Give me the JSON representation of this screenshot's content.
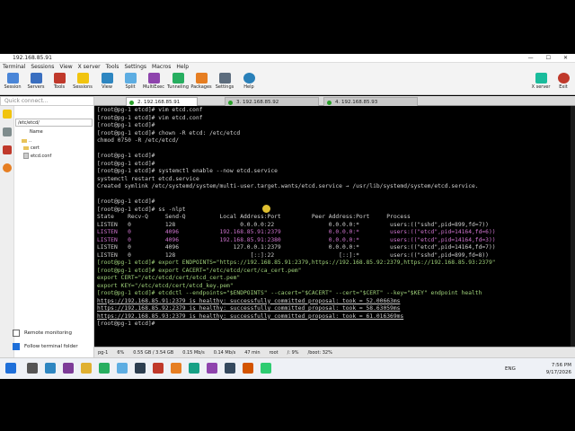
{
  "window": {
    "title": "192.168.85.91",
    "controls": [
      "—",
      "☐",
      "✕"
    ]
  },
  "menu": [
    "Terminal",
    "Sessions",
    "View",
    "X server",
    "Tools",
    "Settings",
    "Macros",
    "Help"
  ],
  "toolbar": {
    "items": [
      "Session",
      "Servers",
      "Tools",
      "Sessions",
      "View",
      "Split",
      "MultiExec",
      "Tunneling",
      "Packages",
      "Settings",
      "Help"
    ],
    "right": [
      "X server",
      "Exit"
    ]
  },
  "quick_connect": {
    "placeholder": "Quick connect..."
  },
  "sidebar": {
    "path": "/etc/etcd/",
    "header": "Name",
    "items": [
      "..",
      "cert",
      "etcd.conf"
    ],
    "remote_monitoring": "Remote monitoring",
    "follow_folder": "Follow terminal folder"
  },
  "tabs": [
    "2. 192.168.85.91",
    "3. 192.168.85.92",
    "4. 192.168.85.93"
  ],
  "terminal": {
    "lines": [
      "[root@pg-1 etcd]# vim etcd.conf",
      "[root@pg-1 etcd]# vim etcd.conf",
      "[root@pg-1 etcd]#",
      "[root@pg-1 etcd]# chown -R etcd: /etc/etcd",
      "chmod 0750 -R /etc/etcd/",
      "",
      "[root@pg-1 etcd]#",
      "[root@pg-1 etcd]#",
      "[root@pg-1 etcd]# systemctl enable --now etcd.service",
      "systemctl restart etcd.service",
      "Created symlink /etc/systemd/system/multi-user.target.wants/etcd.service → /usr/lib/systemd/system/etcd.service.",
      "",
      "[root@pg-1 etcd]#",
      "[root@pg-1 etcd]# ss -nlpt",
      "State    Recv-Q     Send-Q          Local Address:Port         Peer Address:Port     Process",
      "LISTEN   0          128                   0.0.0.0:22                0.0.0.0:*         users:((\"sshd\",pid=899,fd=7))",
      "LISTEN   0          4096            192.168.85.91:2379              0.0.0.0:*         users:((\"etcd\",pid=14164,fd=6))",
      "LISTEN   0          4096            192.168.85.91:2380              0.0.0.0:*         users:((\"etcd\",pid=14164,fd=3))",
      "LISTEN   0          4096                127.0.0.1:2379              0.0.0.0:*         users:((\"etcd\",pid=14164,fd=7))",
      "LISTEN   0          128                      [::]:22                   [::]:*         users:((\"sshd\",pid=899,fd=8))",
      "[root@pg-1 etcd]# export ENDPOINTS=\"https://192.168.85.91:2379,https://192.168.85.92:2379,https://192.168.85.93:2379\"",
      "[root@pg-1 etcd]# export CACERT=\"/etc/etcd/cert/ca_cert.pem\"",
      "export CERT=\"/etc/etcd/cert/etcd_cert.pem\"",
      "export KEY=\"/etc/etcd/cert/etcd_key.pem\"",
      "[root@pg-1 etcd]# etcdctl --endpoints=\"$ENDPOINTS\" --cacert=\"$CACERT\" --cert=\"$CERT\" --key=\"$KEY\" endpoint health",
      "https://192.168.85.91:2379 is healthy: successfully committed proposal: took = 52.00663ms",
      "https://192.168.85.92:2379 is healthy: successfully committed proposal: took = 58.63059ms",
      "https://192.168.85.93:2379 is healthy: successfully committed proposal: took = 61.016369ms",
      "[root@pg-1 etcd]# "
    ]
  },
  "status": [
    "pg-1",
    "6%",
    "0.55 GB / 3.54 GB",
    "0.15 Mb/s",
    "0.14 Mb/s",
    "47 min",
    "root",
    "/: 9%",
    "/boot: 32%"
  ],
  "taskbar": {
    "lang": "ENG",
    "time": "7:56 PM",
    "date": "9/17/2026"
  },
  "colors": {
    "prompt": "#d0d0d0",
    "ip_highlight": "#d075d0",
    "string": "#9fd17a",
    "accent": "#1e6fd9"
  }
}
